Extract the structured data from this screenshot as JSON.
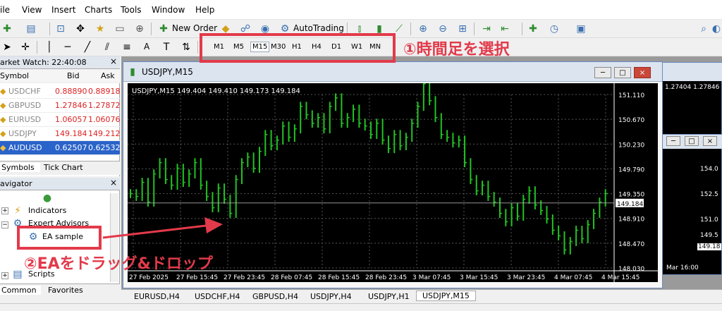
{
  "menu": [
    "ile",
    "View",
    "Insert",
    "Charts",
    "Tools",
    "Window",
    "Help"
  ],
  "toolbar1": {
    "new_order": "New Order",
    "autotrading": "AutoTrading"
  },
  "toolbar2": {
    "text_tool": "A",
    "timeframes": [
      "M1",
      "M5",
      "M15",
      "M30",
      "H1",
      "H4",
      "D1",
      "W1",
      "MN"
    ]
  },
  "market_watch": {
    "title": "arket Watch: 22:40:08",
    "headers": [
      "Symbol",
      "Bid",
      "Ask"
    ],
    "rows": [
      {
        "symbol": "USDCHF",
        "bid": "0.88890",
        "ask": "0.88918"
      },
      {
        "symbol": "GBPUSD",
        "bid": "1.27846",
        "ask": "1.27872"
      },
      {
        "symbol": "EURUSD",
        "bid": "1.06057",
        "ask": "1.06076"
      },
      {
        "symbol": "USDJPY",
        "bid": "149.184",
        "ask": "149.212"
      },
      {
        "symbol": "AUDUSD",
        "bid": "0.62507",
        "ask": "0.62532"
      }
    ],
    "tabs": [
      "Symbols",
      "Tick Chart"
    ]
  },
  "navigator": {
    "title": "avigator",
    "items": [
      "Indicators",
      "Expert Advisors",
      "EA sample",
      "Scripts"
    ],
    "tabs": [
      "Common",
      "Favorites"
    ]
  },
  "chart_window": {
    "title": "USDJPY,M15",
    "info": "USDJPY,M15  149.404 149.410 149.173 149.184",
    "price_axis": [
      "151.110",
      "150.670",
      "150.230",
      "149.790",
      "149.350",
      "148.910",
      "148.470",
      "148.030"
    ],
    "current_price": "149.184",
    "time_axis": [
      "27 Feb 2025",
      "27 Feb 15:45",
      "27 Feb 23:45",
      "28 Feb 07:45",
      "28 Feb 15:45",
      "28 Feb 23:45",
      "3 Mar 07:45",
      "3 Mar 15:45",
      "3 Mar 23:45",
      "4 Mar 07:45",
      "4 Mar 15:45"
    ],
    "ylim": [
      148.03,
      151.11
    ],
    "close_series": [
      149.35,
      149.3,
      149.55,
      149.2,
      149.7,
      149.9,
      149.6,
      149.5,
      149.8,
      149.55,
      149.7,
      149.9,
      149.5,
      149.3,
      149.1,
      149.45,
      149.25,
      149.0,
      149.6,
      149.9,
      150.0,
      149.8,
      150.1,
      150.4,
      150.2,
      150.3,
      150.55,
      150.35,
      150.5,
      150.9,
      150.75,
      150.6,
      150.7,
      150.5,
      150.9,
      151.05,
      150.6,
      150.7,
      150.85,
      150.6,
      150.55,
      150.4,
      150.6,
      150.3,
      150.15,
      150.4,
      150.2,
      150.35,
      150.6,
      150.9,
      151.3,
      151.0,
      150.7,
      150.4,
      150.35,
      150.25,
      150.3,
      149.9,
      149.6,
      149.4,
      149.5,
      149.3,
      149.2,
      149.0,
      148.85,
      149.1,
      148.95,
      149.25,
      149.4,
      149.15,
      149.05,
      148.9,
      148.7,
      148.6,
      148.35,
      148.5,
      148.7,
      148.55,
      148.8,
      149.0,
      149.2,
      149.35
    ]
  },
  "back_windows": {
    "prices_top": "1.27404 1.27846",
    "price_axis2": [
      "154.0",
      "152.5",
      "151.0",
      "149.5"
    ],
    "price_axis2_current": "149.18",
    "time_label2": "Mar 16:00"
  },
  "bottom_tabs": [
    "EURUSD,H4",
    "USDCHF,H4",
    "GBPUSD,H4",
    "USDJPY,H4",
    "USDJPY,H1",
    "USDJPY,M15"
  ],
  "annotations": {
    "step1": "①時間足を選択",
    "step2": "②EAをドラッグ&ドロップ"
  }
}
